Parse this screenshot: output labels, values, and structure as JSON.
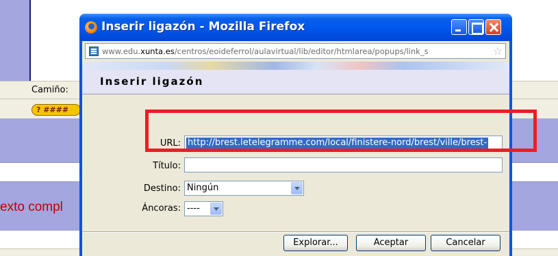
{
  "background": {
    "path_label": "Camiño:",
    "help_button": "? ####",
    "body_text": "exto compl",
    "colors": {
      "panel": "#a3a6df",
      "body_text": "#c00000",
      "toolbar": "#f1efe2"
    }
  },
  "window": {
    "title": "Inserir ligazón - Mozilla Firefox",
    "url_host": "www.edu.",
    "url_domain": "xunta.es",
    "url_path": "/centros/eoideferrol/aulavirtual/lib/editor/htmlarea/popups/link_s",
    "icons": [
      "firefox-icon",
      "site-icon",
      "bookmark-star-icon",
      "minimize-icon",
      "maximize-icon",
      "close-icon"
    ]
  },
  "dialog": {
    "title": "Inserir ligazón",
    "url_label": "URL:",
    "url_value": "http://brest.letelegramme.com/local/finistere-nord/brest/ville/brest-",
    "title_label": "Título:",
    "title_value": "",
    "target_label": "Destino:",
    "target_value": "Ningún",
    "anchors_label": "Áncoras:",
    "anchors_value": "----",
    "buttons": {
      "explore": "Explorar...",
      "accept": "Aceptar",
      "cancel": "Cancelar"
    }
  },
  "annotation": {
    "highlight_color": "#ee1c24"
  }
}
